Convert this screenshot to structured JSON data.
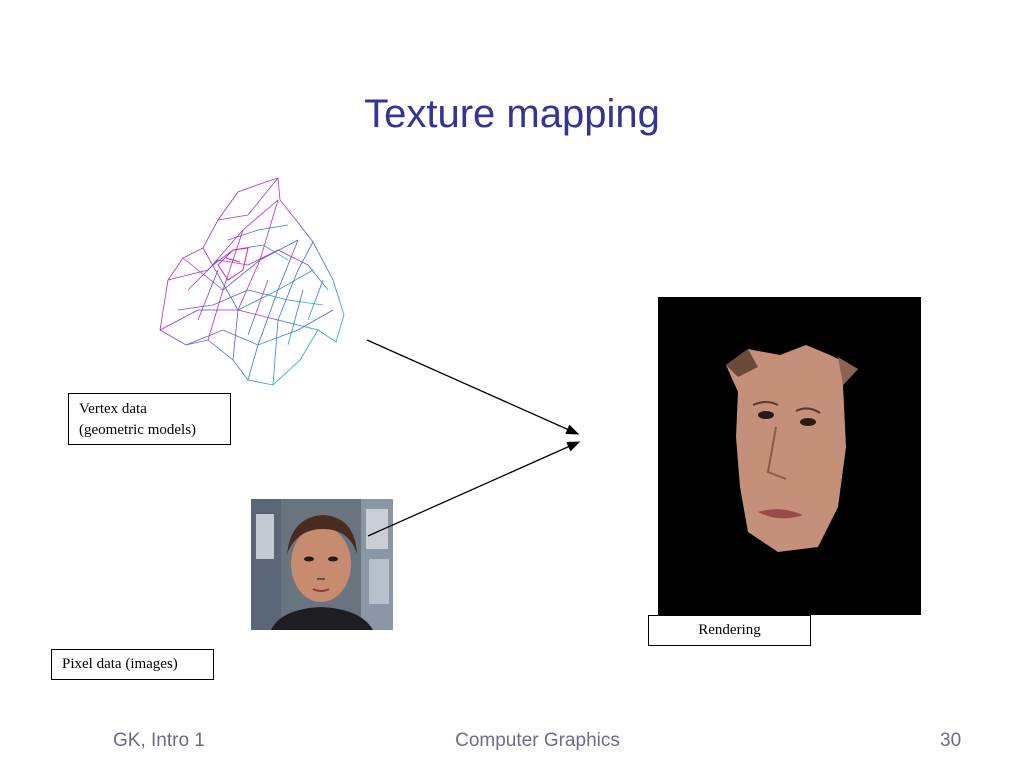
{
  "slide": {
    "title": "Texture mapping",
    "vertex_label_line1": "Vertex data",
    "vertex_label_line2": "(geometric models)",
    "pixel_label": "Pixel data (images)",
    "rendering_label": "Rendering"
  },
  "footer": {
    "left": "GK, Intro 1",
    "center": "Computer Graphics",
    "right": "30"
  },
  "colors": {
    "title": "#333399",
    "footer_text": "#6b6b8a",
    "render_background": "#000000"
  },
  "images": {
    "mesh": "wireframe-face-mesh",
    "photo": "face-photograph",
    "render": "texture-mapped-face-render"
  }
}
